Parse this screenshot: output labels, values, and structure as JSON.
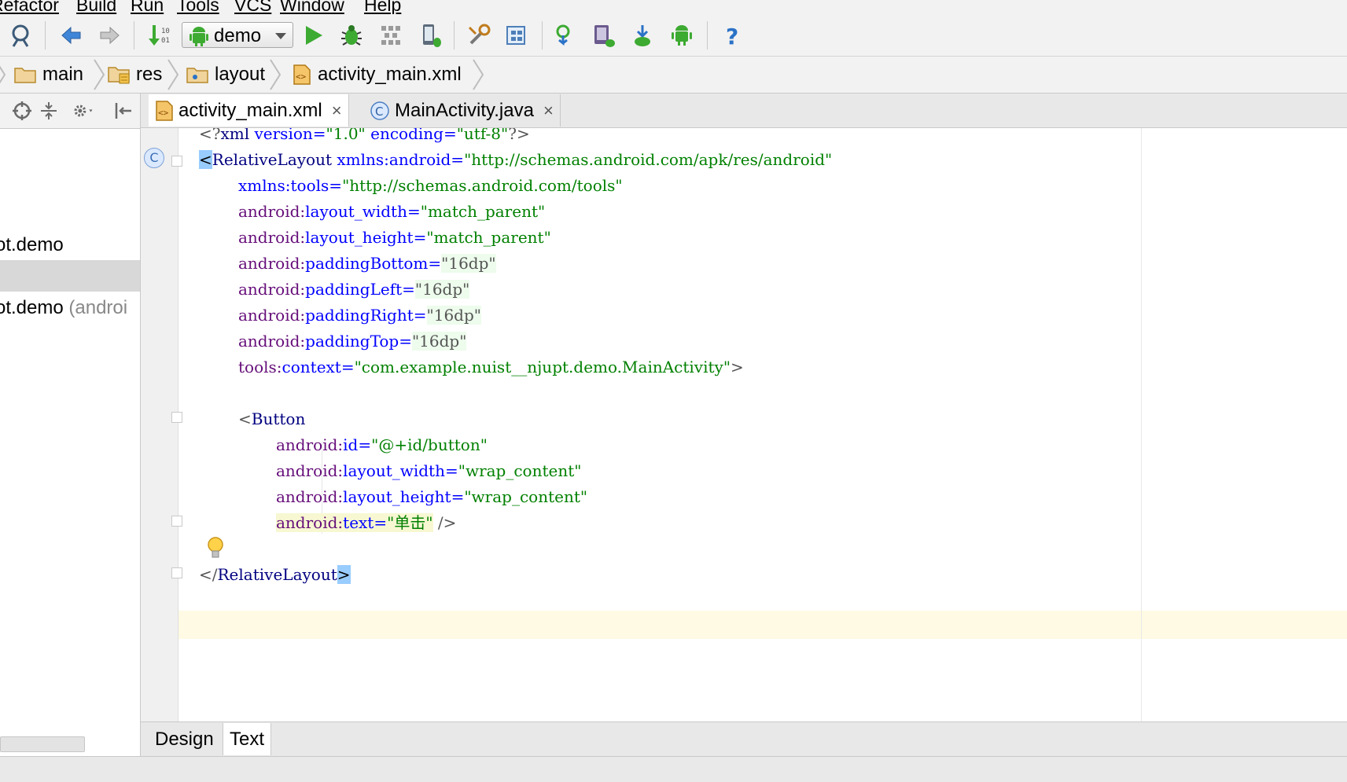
{
  "menu": {
    "items": [
      "Refactor",
      "Build",
      "Run",
      "Tools",
      "VCS",
      "Window",
      "Help"
    ]
  },
  "toolbar": {
    "run_config": "demo",
    "icons": [
      "search-structure-icon",
      "back-arrow-icon",
      "forward-arrow-icon",
      "make-project-icon",
      "run-icon",
      "debug-icon",
      "coverage-icon",
      "attach-debugger-icon",
      "project-structure-icon",
      "project-settings-icon",
      "sync-gradle-icon",
      "avd-manager-icon",
      "sdk-manager-icon",
      "android-monitor-icon",
      "help-icon"
    ]
  },
  "breadcrumb": {
    "items": [
      {
        "label": "main",
        "icon": "folder-icon"
      },
      {
        "label": "res",
        "icon": "resource-folder-icon"
      },
      {
        "label": "layout",
        "icon": "layout-folder-icon"
      },
      {
        "label": "activity_main.xml",
        "icon": "xml-file-icon"
      }
    ]
  },
  "project_tree": {
    "rows": [
      {
        "label": "ot.demo",
        "suffix": ""
      },
      {
        "label": "ot.demo",
        "suffix": " (androi"
      }
    ]
  },
  "editor_tabs": [
    {
      "label": "activity_main.xml",
      "icon": "xml-file-icon",
      "close": "×",
      "active": true
    },
    {
      "label": "MainActivity.java",
      "icon": "class-icon",
      "close": "×",
      "active": false
    }
  ],
  "code": {
    "class_marker": "C",
    "line1": {
      "open": "<?",
      "tag": "xml",
      "a1": " version=",
      "v1": "\"1.0\"",
      "a2": " encoding=",
      "v2": "\"utf-8\"",
      "close": "?>"
    },
    "line2": {
      "open": "<",
      "tag": "RelativeLayout",
      "attr": " xmlns:android=",
      "val": "\"http://schemas.android.com/apk/res/android\""
    },
    "line3": {
      "attr": "xmlns:tools=",
      "val": "\"http://schemas.android.com/tools\""
    },
    "line4": {
      "ns": "android:",
      "attr": "layout_width",
      "eq": "=",
      "val": "\"match_parent\""
    },
    "line5": {
      "ns": "android:",
      "attr": "layout_height",
      "eq": "=",
      "val": "\"match_parent\""
    },
    "line6": {
      "ns": "android:",
      "attr": "paddingBottom",
      "eq": "=",
      "val": "\"16dp\""
    },
    "line7": {
      "ns": "android:",
      "attr": "paddingLeft",
      "eq": "=",
      "val": "\"16dp\""
    },
    "line8": {
      "ns": "android:",
      "attr": "paddingRight",
      "eq": "=",
      "val": "\"16dp\""
    },
    "line9": {
      "ns": "android:",
      "attr": "paddingTop",
      "eq": "=",
      "val": "\"16dp\""
    },
    "line10": {
      "ns": "tools:",
      "attr": "context",
      "eq": "=",
      "val": "\"com.example.nuist__njupt.demo.MainActivity\"",
      "close": ">"
    },
    "line12": {
      "open": "<",
      "tag": "Button"
    },
    "line13": {
      "ns": "android:",
      "attr": "id",
      "eq": "=",
      "val": "\"@+id/button\""
    },
    "line14": {
      "ns": "android:",
      "attr": "layout_width",
      "eq": "=",
      "val": "\"wrap_content\""
    },
    "line15": {
      "ns": "android:",
      "attr": "layout_height",
      "eq": "=",
      "val": "\"wrap_content\""
    },
    "line16": {
      "ns": "android:",
      "attr": "text",
      "eq": "=",
      "val": "\"单击\"",
      "close": " />"
    },
    "line18": {
      "open": "</",
      "tag": "RelativeLayout",
      "close": ">"
    }
  },
  "bottom_tabs": [
    {
      "label": "Design",
      "active": false
    },
    {
      "label": "Text",
      "active": true
    }
  ],
  "colors": {
    "tag": "#000080",
    "attr": "#0000ff",
    "value": "#008000",
    "accent_green": "#3daa32"
  }
}
